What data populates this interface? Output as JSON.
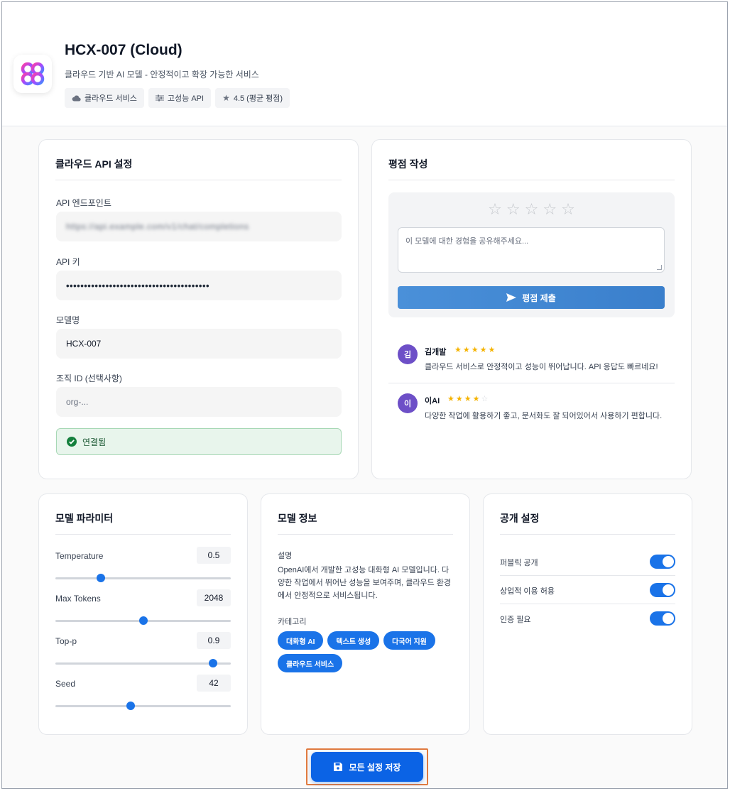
{
  "header": {
    "title": "HCX-007 (Cloud)",
    "subtitle": "클라우드 기반 AI 모델 - 안정적이고 확장 가능한 서비스",
    "tags": [
      {
        "icon": "cloud-icon",
        "label": "클라우드 서비스"
      },
      {
        "icon": "sliders-icon",
        "label": "고성능 API"
      },
      {
        "icon": "star-icon",
        "label": "4.5 (평균 평점)"
      }
    ]
  },
  "api_settings": {
    "title": "클라우드 API 설정",
    "endpoint_label": "API 엔드포인트",
    "endpoint_value": "https://api.example.com/v1/chat/completions",
    "key_label": "API 키",
    "key_value": "••••••••••••••••••••••••••••••••••••••••",
    "model_label": "모델명",
    "model_value": "HCX-007",
    "org_label": "조직 ID (선택사항)",
    "org_placeholder": "org-...",
    "status": "연결됨"
  },
  "rating": {
    "title": "평점 작성",
    "placeholder": "이 모델에 대한 경험을 공유해주세요...",
    "submit_label": "평점 제출",
    "reviews": [
      {
        "initial": "김",
        "name": "김개발",
        "stars": 5,
        "text": "클라우드 서비스로 안정적이고 성능이 뛰어납니다. API 응답도 빠르네요!"
      },
      {
        "initial": "이",
        "name": "이AI",
        "stars": 4,
        "text": "다양한 작업에 활용하기 좋고, 문서화도 잘 되어있어서 사용하기 편합니다."
      }
    ]
  },
  "params": {
    "title": "모델 파라미터",
    "items": [
      {
        "label": "Temperature",
        "value": "0.5",
        "fraction": 0.26
      },
      {
        "label": "Max Tokens",
        "value": "2048",
        "fraction": 0.5
      },
      {
        "label": "Top-p",
        "value": "0.9",
        "fraction": 0.9
      },
      {
        "label": "Seed",
        "value": "42",
        "fraction": 0.43
      }
    ]
  },
  "model_info": {
    "title": "모델 정보",
    "desc_label": "설명",
    "description": "OpenAI에서 개발한 고성능 대화형 AI 모델입니다. 다양한 작업에서 뛰어난 성능을 보여주며, 클라우드 환경에서 안정적으로 서비스됩니다.",
    "category_label": "카테고리",
    "categories": [
      "대화형 AI",
      "텍스트 생성",
      "다국어 지원",
      "클라우드 서비스"
    ]
  },
  "visibility": {
    "title": "공개 설정",
    "toggles": [
      {
        "label": "퍼블릭 공개",
        "on": true
      },
      {
        "label": "상업적 이용 허용",
        "on": true
      },
      {
        "label": "인증 필요",
        "on": true
      }
    ]
  },
  "save_label": "모든 설정 저장",
  "colors": {
    "accent": "#1a73e8",
    "save": "#0b63e5",
    "star": "#f5b301",
    "avatar": "#6d4fc7",
    "success_bg": "#e8f5ec"
  }
}
